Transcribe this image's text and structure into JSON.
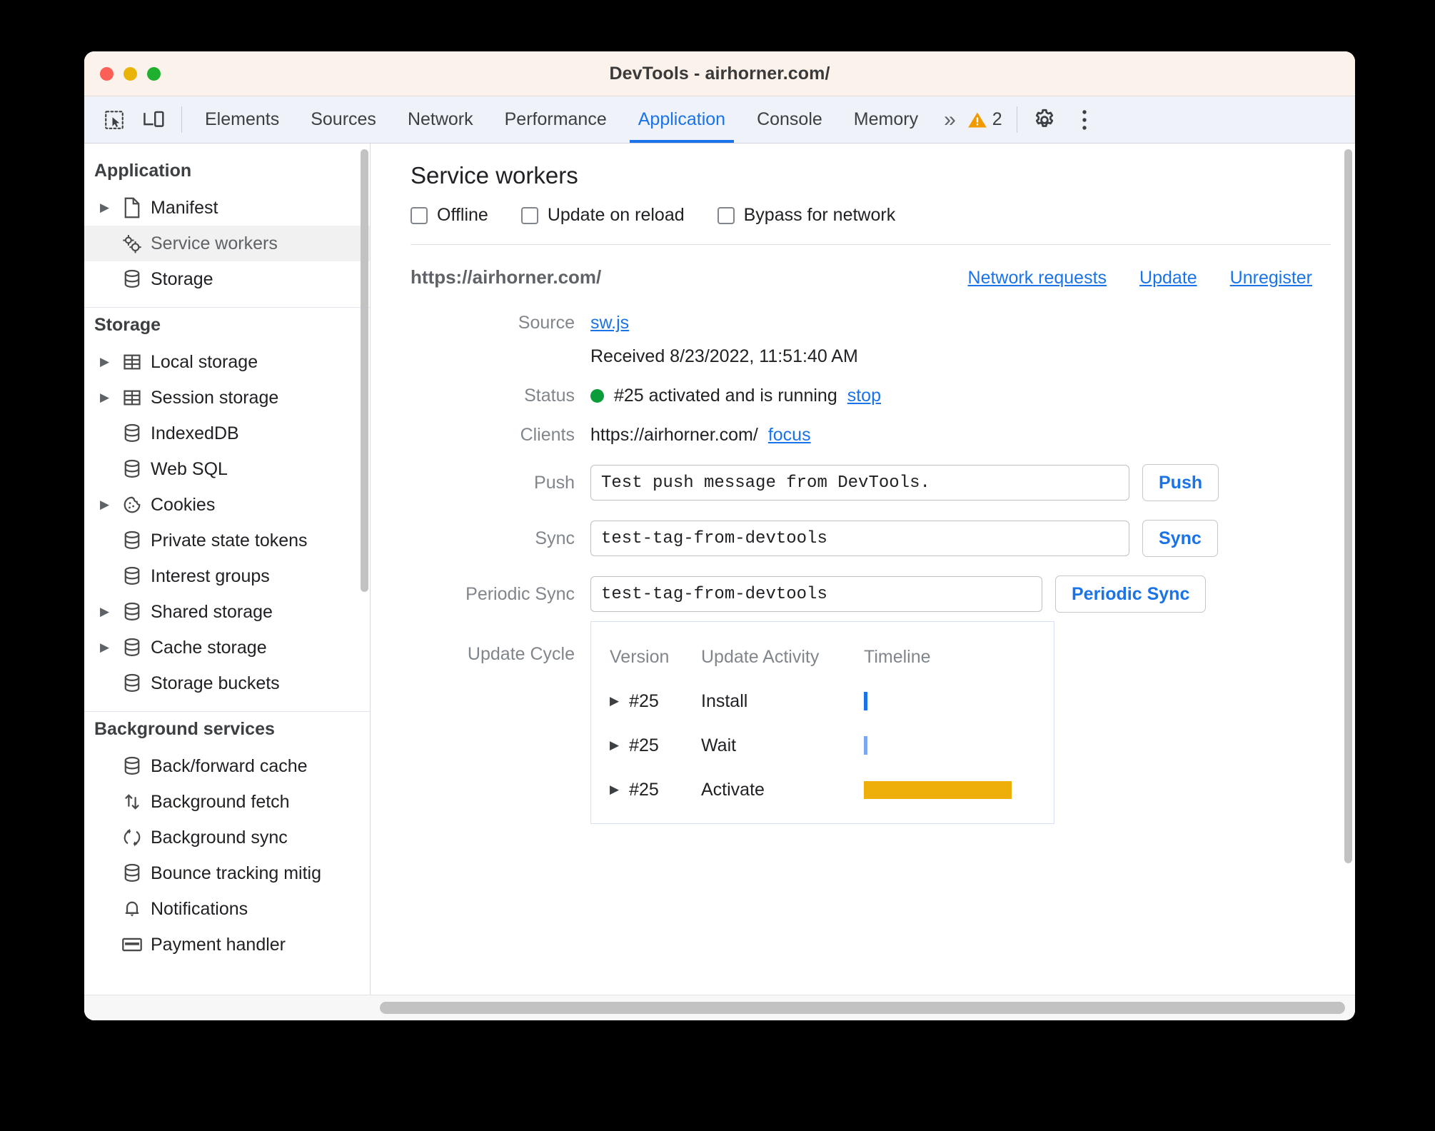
{
  "window": {
    "title": "DevTools - airhorner.com/",
    "traffic_lights": [
      "close-red",
      "minimize-yellow",
      "maximize-green"
    ]
  },
  "toolbar": {
    "icons": [
      {
        "name": "inspect-element-icon",
        "label": "Inspect element"
      },
      {
        "name": "device-toolbar-icon",
        "label": "Toggle device toolbar"
      }
    ],
    "tabs": [
      {
        "label": "Elements",
        "active": false
      },
      {
        "label": "Sources",
        "active": false
      },
      {
        "label": "Network",
        "active": false
      },
      {
        "label": "Performance",
        "active": false
      },
      {
        "label": "Application",
        "active": true
      },
      {
        "label": "Console",
        "active": false
      },
      {
        "label": "Memory",
        "active": false
      }
    ],
    "overflow_label": "»",
    "warning_count": "2",
    "settings_label": "Settings",
    "more_label": "Customize and control DevTools"
  },
  "sidebar": {
    "groups": [
      {
        "header": "Application",
        "items": [
          {
            "label": "Manifest",
            "icon": "document-icon",
            "expandable": true,
            "selected": false
          },
          {
            "label": "Service workers",
            "icon": "gears-icon",
            "expandable": false,
            "selected": true
          },
          {
            "label": "Storage",
            "icon": "database-icon",
            "expandable": false,
            "selected": false
          }
        ]
      },
      {
        "header": "Storage",
        "items": [
          {
            "label": "Local storage",
            "icon": "table-icon",
            "expandable": true,
            "selected": false
          },
          {
            "label": "Session storage",
            "icon": "table-icon",
            "expandable": true,
            "selected": false
          },
          {
            "label": "IndexedDB",
            "icon": "database-icon",
            "expandable": false,
            "selected": false
          },
          {
            "label": "Web SQL",
            "icon": "database-icon",
            "expandable": false,
            "selected": false
          },
          {
            "label": "Cookies",
            "icon": "cookie-icon",
            "expandable": true,
            "selected": false
          },
          {
            "label": "Private state tokens",
            "icon": "database-icon",
            "expandable": false,
            "selected": false
          },
          {
            "label": "Interest groups",
            "icon": "database-icon",
            "expandable": false,
            "selected": false
          },
          {
            "label": "Shared storage",
            "icon": "database-icon",
            "expandable": true,
            "selected": false
          },
          {
            "label": "Cache storage",
            "icon": "database-icon",
            "expandable": true,
            "selected": false
          },
          {
            "label": "Storage buckets",
            "icon": "database-icon",
            "expandable": false,
            "selected": false
          }
        ]
      },
      {
        "header": "Background services",
        "items": [
          {
            "label": "Back/forward cache",
            "icon": "database-icon",
            "expandable": false,
            "selected": false
          },
          {
            "label": "Background fetch",
            "icon": "arrows-updown-icon",
            "expandable": false,
            "selected": false
          },
          {
            "label": "Background sync",
            "icon": "sync-icon",
            "expandable": false,
            "selected": false
          },
          {
            "label": "Bounce tracking mitig",
            "icon": "database-icon",
            "expandable": false,
            "selected": false
          },
          {
            "label": "Notifications",
            "icon": "bell-icon",
            "expandable": false,
            "selected": false
          },
          {
            "label": "Payment handler",
            "icon": "card-icon",
            "expandable": false,
            "selected": false
          }
        ]
      }
    ]
  },
  "main": {
    "title": "Service workers",
    "checkboxes": [
      {
        "label": "Offline",
        "checked": false
      },
      {
        "label": "Update on reload",
        "checked": false
      },
      {
        "label": "Bypass for network",
        "checked": false
      }
    ],
    "registration": {
      "scope_url": "https://airhorner.com/",
      "links": [
        {
          "label": "Network requests"
        },
        {
          "label": "Update"
        },
        {
          "label": "Unregister"
        }
      ],
      "source": {
        "label": "Source",
        "file": "sw.js",
        "received": "Received 8/23/2022, 11:51:40 AM"
      },
      "status": {
        "label": "Status",
        "text": "#25 activated and is running",
        "action": "stop",
        "dot_color": "#0a9d3a"
      },
      "clients": {
        "label": "Clients",
        "url": "https://airhorner.com/",
        "action": "focus"
      },
      "push": {
        "label": "Push",
        "value": "Test push message from DevTools.",
        "button": "Push"
      },
      "sync": {
        "label": "Sync",
        "value": "test-tag-from-devtools",
        "button": "Sync"
      },
      "periodic_sync": {
        "label": "Periodic Sync",
        "value": "test-tag-from-devtools",
        "button": "Periodic Sync"
      },
      "update_cycle": {
        "label": "Update Cycle",
        "columns": [
          "Version",
          "Update Activity",
          "Timeline"
        ],
        "rows": [
          {
            "version": "#25",
            "activity": "Install",
            "bar": "bar-install"
          },
          {
            "version": "#25",
            "activity": "Wait",
            "bar": "bar-wait"
          },
          {
            "version": "#25",
            "activity": "Activate",
            "bar": "bar-activate"
          }
        ]
      }
    }
  },
  "colors": {
    "accent": "#1a73e8",
    "status_green": "#0a9d3a",
    "activate_bar": "#eeaf0b",
    "warning": "#f29900"
  }
}
